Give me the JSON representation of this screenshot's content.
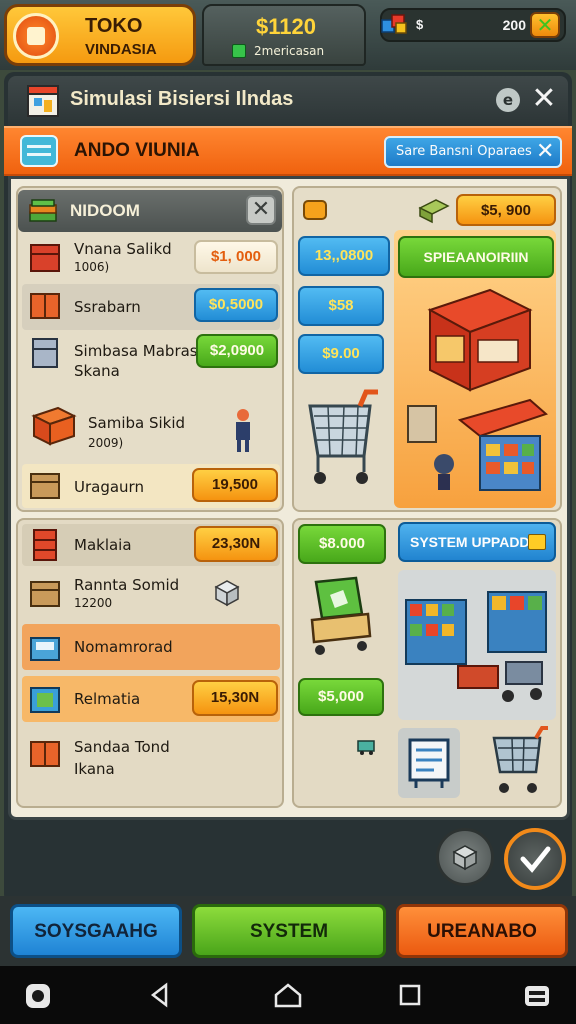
{
  "top": {
    "shop_line1": "TOKO",
    "shop_line2": "VINDASIA",
    "money_value": "$1120",
    "money_sub": "2mericasan",
    "gems_left": "$",
    "gems_right": "200"
  },
  "header": {
    "title": "Simulasi Bisiersi Ilndas",
    "info_label": "e",
    "close_label": "✕"
  },
  "subheader": {
    "label": "ANDO VIUNIA",
    "button_label": "Sare Bansni Oparaes",
    "button_close": "✕"
  },
  "left_top": {
    "header_label": "NIDOOM",
    "close_label": "✕",
    "items": [
      {
        "name": "Vnana Salikd",
        "sub": "1006)",
        "price": "$1, 000",
        "style": "white"
      },
      {
        "name": "Ssrabarn",
        "sub": "",
        "price": "$0,5000",
        "style": "blue"
      },
      {
        "name": "Simbasa Mabras",
        "sub": "Skana",
        "price": "$2,0900",
        "style": "green"
      },
      {
        "name": "Samiba Sikid",
        "sub": "2009)",
        "price": "",
        "style": "none"
      },
      {
        "name": "Uragaurn",
        "sub": "",
        "price": "19,500",
        "style": "orange"
      }
    ]
  },
  "right_top": {
    "top_price": "$5, 900",
    "prices": [
      "13,,0800",
      "$58",
      "$9.00"
    ],
    "green_button": "SPIEAANOIRIIN"
  },
  "left_bottom": {
    "items": [
      {
        "name": "Maklaia",
        "sub": "",
        "price": "23,30N",
        "style": "orange"
      },
      {
        "name": "Rannta Somid",
        "sub": "12200",
        "price": "",
        "style": "none"
      },
      {
        "name": "Nomamrorad",
        "sub": "",
        "price": "",
        "style": "none"
      },
      {
        "name": "Relmatia",
        "sub": "",
        "price": "15,30N",
        "style": "orange"
      },
      {
        "name": "Sandaa Tond",
        "sub": "Ikana",
        "price": "",
        "style": "none"
      }
    ]
  },
  "right_bottom": {
    "price1": "$8.000",
    "price2": "$5,000",
    "system_update": "SYSTEM UPPADD"
  },
  "bottom_buttons": {
    "left": "SOYSGAAHG",
    "mid": "SYSTEM",
    "right": "UREANABO"
  },
  "colors": {
    "orange": "#f0620f",
    "blue": "#228dd6",
    "green": "#48a81a",
    "gold": "#f59310"
  }
}
